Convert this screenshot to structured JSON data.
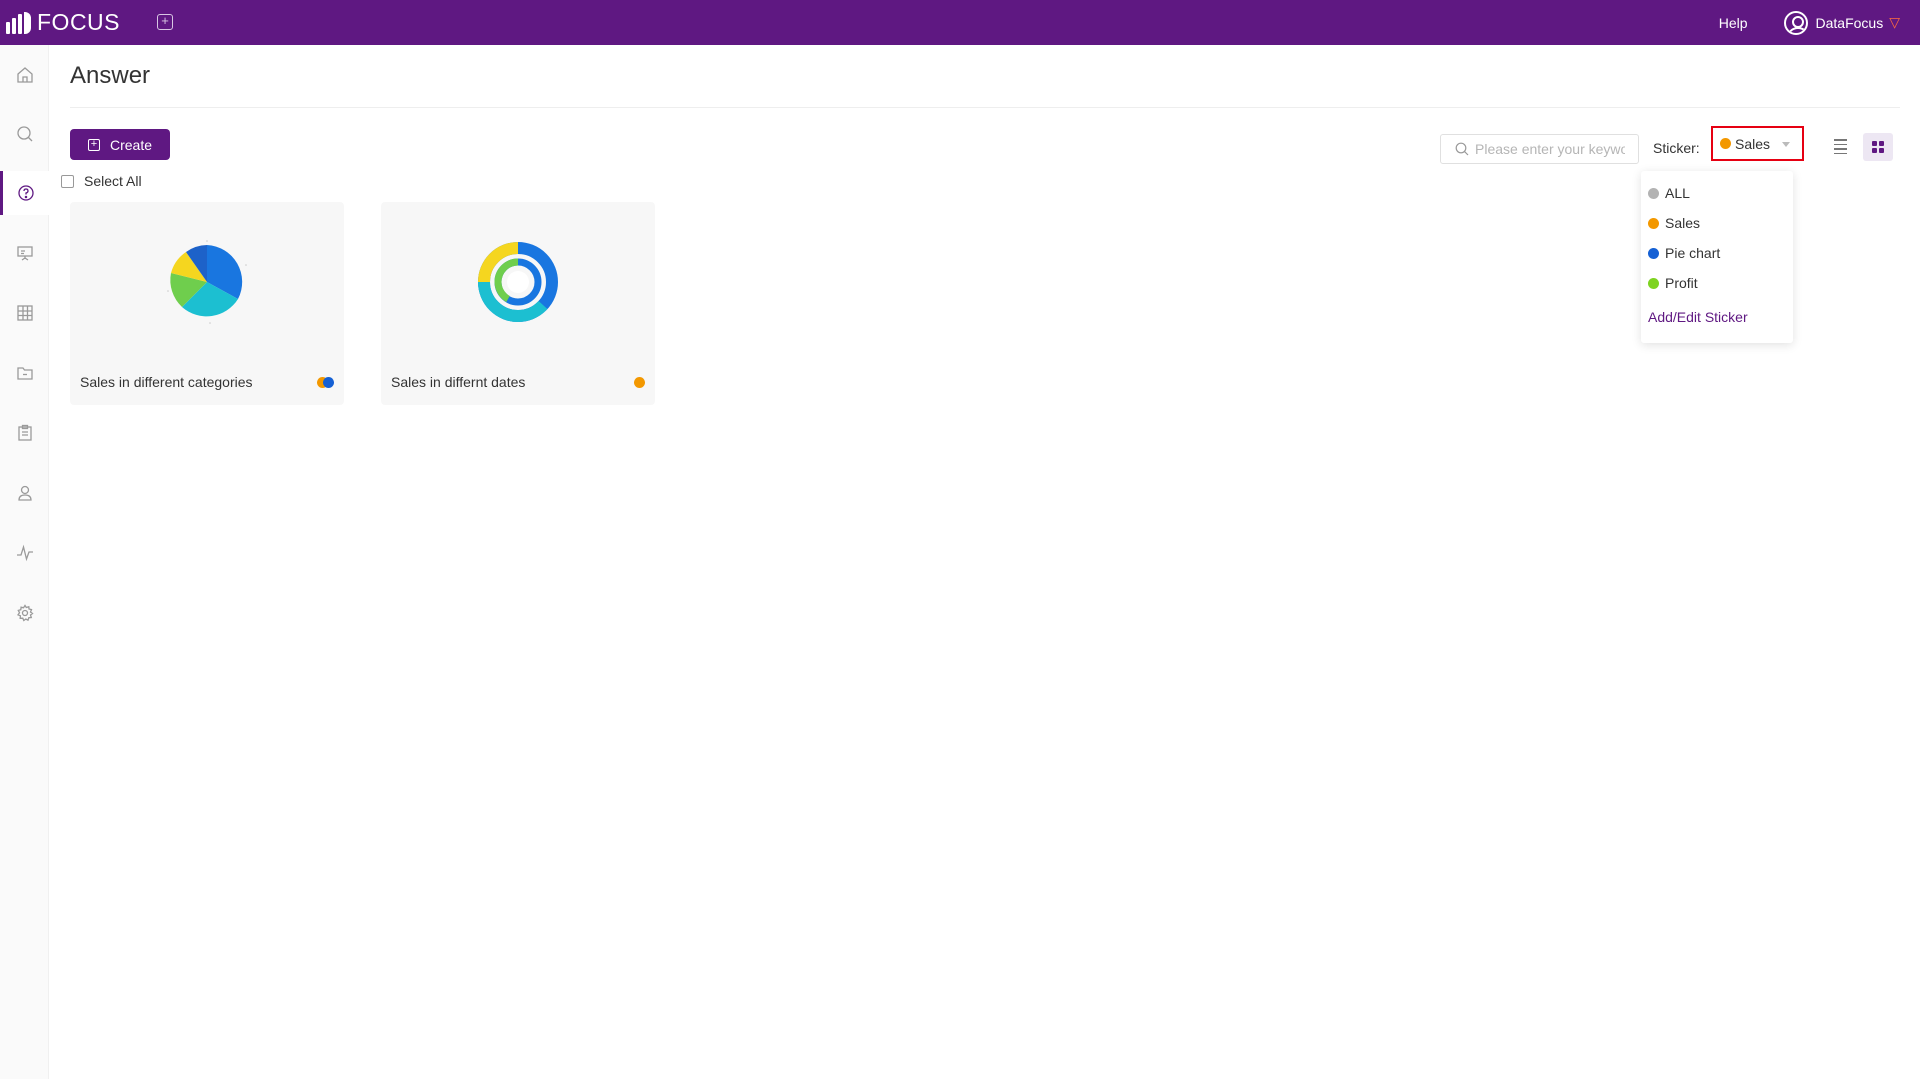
{
  "topbar": {
    "logo_text": "FOCUS",
    "help_label": "Help",
    "user_name": "DataFocus",
    "accent_color": "#5f1882"
  },
  "sidebar": {
    "items": [
      {
        "icon": "home-icon"
      },
      {
        "icon": "search-icon"
      },
      {
        "icon": "question-icon",
        "active": true
      },
      {
        "icon": "presentation-icon"
      },
      {
        "icon": "table-icon"
      },
      {
        "icon": "folder-icon"
      },
      {
        "icon": "clipboard-icon"
      },
      {
        "icon": "user-icon"
      },
      {
        "icon": "activity-icon"
      },
      {
        "icon": "gear-icon"
      }
    ]
  },
  "main": {
    "title": "Answer",
    "create_label": "Create",
    "select_all_label": "Select All",
    "search_placeholder": "Please enter your keywo",
    "sticker_label": "Sticker:",
    "sticker_selected": "Sales",
    "sticker_selected_color": "#f39800"
  },
  "sticker_dropdown": {
    "items": [
      {
        "label": "ALL",
        "color": "#b3b3b3"
      },
      {
        "label": "Sales",
        "color": "#f39800"
      },
      {
        "label": "Pie chart",
        "color": "#1560d4"
      },
      {
        "label": "Profit",
        "color": "#7ed321"
      }
    ],
    "edit_label": "Add/Edit Sticker"
  },
  "cards": [
    {
      "name": "Sales in different categories",
      "sticker_colors": [
        "#f39800",
        "#1560d4"
      ]
    },
    {
      "name": "Sales in differnt dates",
      "sticker_colors": [
        "#f39800"
      ]
    }
  ]
}
